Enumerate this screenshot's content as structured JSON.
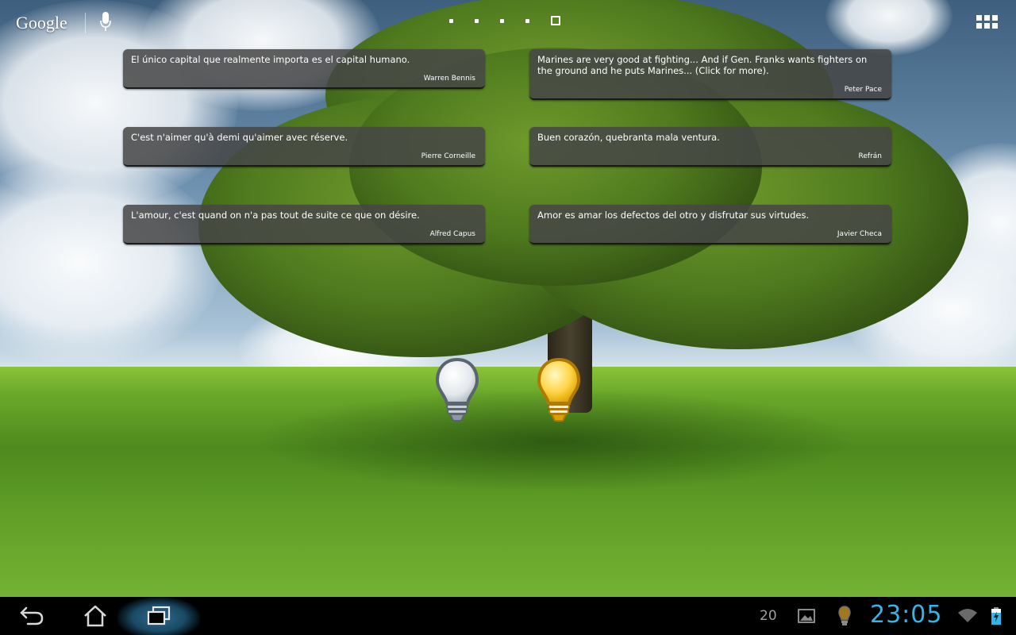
{
  "top_bar": {
    "search_brand": "Google",
    "page_count": 5,
    "active_page": 5
  },
  "quotes": [
    {
      "text": "El único capital que realmente importa es el capital humano.",
      "author": "Warren Bennis"
    },
    {
      "text": "Marines are very good at fighting... And if Gen. Franks wants fighters on the ground and he puts Marines... (Click for more).",
      "author": "Peter Pace"
    },
    {
      "text": "C'est n'aimer qu'à demi qu'aimer avec réserve.",
      "author": "Pierre Corneille"
    },
    {
      "text": "Buen corazón, quebranta mala ventura.",
      "author": "Refrán"
    },
    {
      "text": "L'amour, c'est quand on n'a pas tout de suite ce que on désire.",
      "author": "Alfred Capus"
    },
    {
      "text": "Amor es amar los defectos del otro y disfrutar sus virtudes.",
      "author": "Javier Checa"
    }
  ],
  "bulbs": [
    {
      "state": "off",
      "icon": "lightbulb-off-icon"
    },
    {
      "state": "on",
      "icon": "lightbulb-on-icon"
    }
  ],
  "status_bar": {
    "notification_count": "20",
    "time": "23:05",
    "clock_color": "#33b5e5"
  },
  "nav": {
    "back": "back-icon",
    "home": "home-icon",
    "recent": "recent-apps-icon"
  }
}
